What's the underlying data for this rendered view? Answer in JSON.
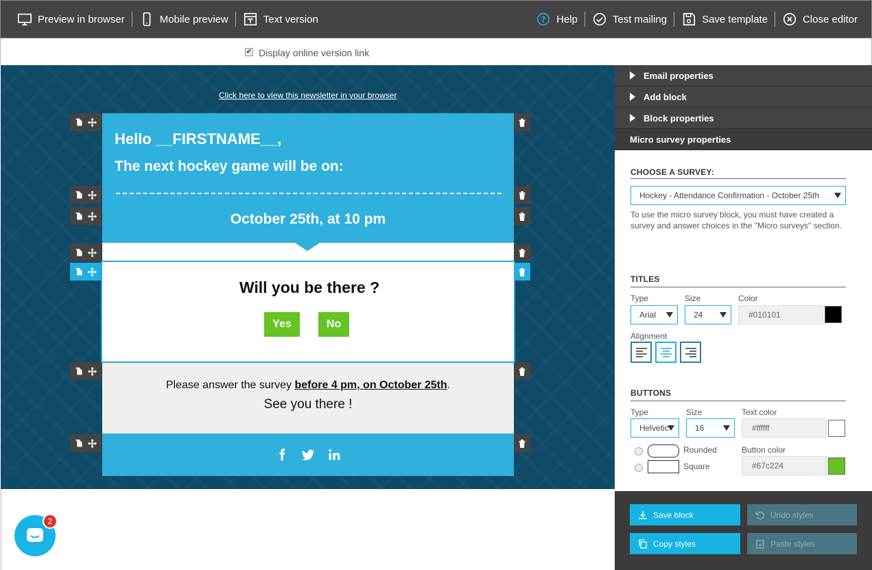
{
  "topbar": {
    "left": [
      "Preview in browser",
      "Mobile preview",
      "Text version"
    ],
    "right": [
      "Help",
      "Test mailing",
      "Save template",
      "Close editor"
    ]
  },
  "online_link": {
    "label": "Display online version link",
    "checked": true
  },
  "email": {
    "view_link": "Click here to view this newsletter in your browser",
    "hello": "Hello __FIRSTNAME__,",
    "next_game": "The next hockey game will be on:",
    "date": "October 25th, at 10 pm",
    "question": "Will you be there ?",
    "yes": "Yes",
    "no": "No",
    "note_prefix": "Please answer the survey ",
    "note_bold": "before 4 pm, on October 25th",
    "note_suffix": ".",
    "see_you": "See you there !",
    "social_icons": [
      "facebook-icon",
      "twitter-icon",
      "linkedin-icon"
    ]
  },
  "panel": {
    "accordion": [
      "Email properties",
      "Add block",
      "Block properties",
      "Micro survey properties"
    ],
    "choose_survey_title": "CHOOSE A SURVEY:",
    "survey_selected": "Hockey - Attendance Confirmation - October 25th",
    "survey_help": "To use the micro survey block, you must have created a survey and answer choices in the \"Micro surveys\" section.",
    "titles": {
      "heading": "TITLES",
      "type_label": "Type",
      "type_value": "Arial",
      "size_label": "Size",
      "size_value": "24",
      "color_label": "Color",
      "color_value": "#010101",
      "alignment_label": "Alignment"
    },
    "buttons": {
      "heading": "BUTTONS",
      "type_label": "Type",
      "type_value": "Helvetic",
      "size_label": "Size",
      "size_value": "16",
      "text_color_label": "Text color",
      "text_color_value": "#ffffff",
      "rounded_label": "Rounded",
      "square_label": "Square",
      "button_color_label": "Button color",
      "button_color_value": "#67c224"
    },
    "actions": {
      "save_block": "Save block",
      "undo_styles": "Undo styles",
      "copy_styles": "Copy styles",
      "paste_styles": "Paste styles"
    }
  },
  "chat": {
    "badge": "2"
  },
  "colors": {
    "accent": "#2fb0dd",
    "button_green": "#67c224",
    "topbar": "#444444",
    "title_color": "#010101",
    "button_text": "#ffffff"
  }
}
